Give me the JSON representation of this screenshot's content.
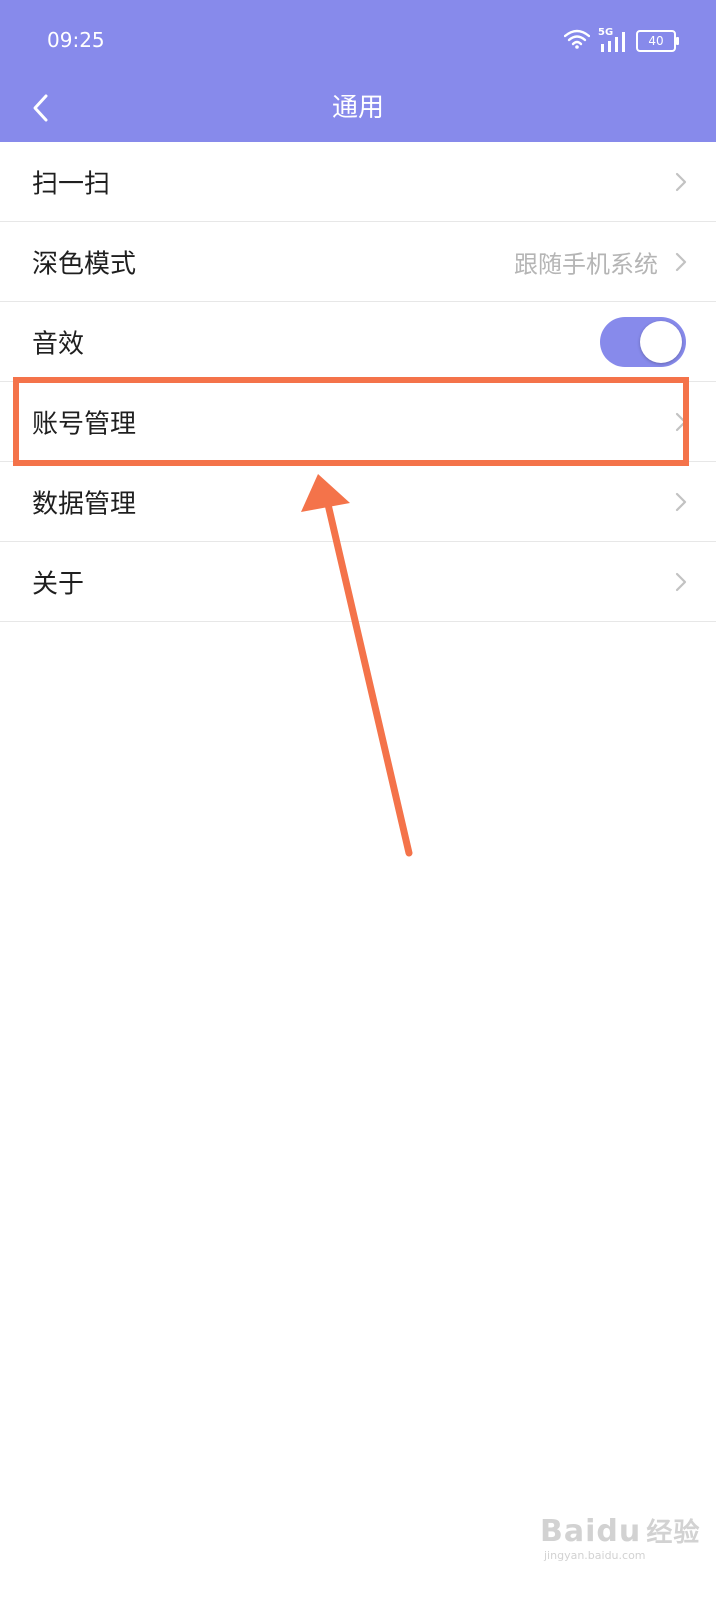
{
  "status_bar": {
    "time": "09:25",
    "signal_label": "5G",
    "battery_level": "40",
    "icons": [
      "wifi-icon",
      "signal-5g-icon",
      "battery-icon"
    ]
  },
  "header": {
    "title": "通用",
    "back_icon": "back-chevron-icon",
    "background_color": "#878aeb"
  },
  "settings": {
    "items": [
      {
        "label": "扫一扫",
        "value": "",
        "control": "chevron"
      },
      {
        "label": "深色模式",
        "value": "跟随手机系统",
        "control": "chevron"
      },
      {
        "label": "音效",
        "value": "",
        "control": "toggle",
        "toggle_on": true
      },
      {
        "label": "账号管理",
        "value": "",
        "control": "chevron",
        "highlighted": true
      },
      {
        "label": "数据管理",
        "value": "",
        "control": "chevron"
      },
      {
        "label": "关于",
        "value": "",
        "control": "chevron"
      }
    ]
  },
  "annotation": {
    "highlight_color": "#f4734a"
  },
  "watermark": {
    "brand": "Bai",
    "brand_suffix": "du",
    "cn": "经验",
    "url": "jingyan.baidu.com"
  }
}
